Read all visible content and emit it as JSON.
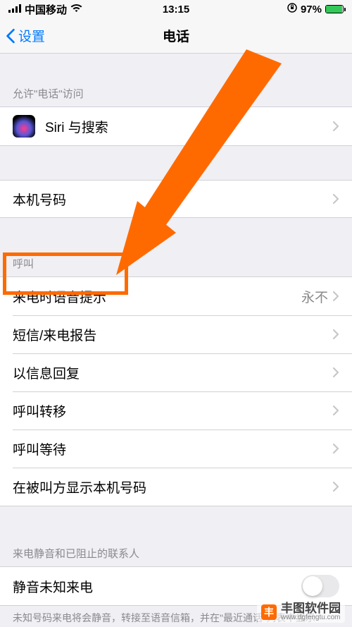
{
  "status": {
    "carrier": "中国移动",
    "time": "13:15",
    "battery": "97%"
  },
  "nav": {
    "back": "设置",
    "title": "电话"
  },
  "section_access": "允许\"电话\"访问",
  "siri": "Siri 与搜索",
  "my_number": "本机号码",
  "section_calls": "呼叫",
  "calls": {
    "announce": {
      "label": "来电时语音提示",
      "value": "永不"
    },
    "report": "短信/来电报告",
    "respond": "以信息回复",
    "forwarding": "呼叫转移",
    "waiting": "呼叫等待",
    "caller_id": "在被叫方显示本机号码"
  },
  "section_silence": "来电静音和已阻止的联系人",
  "silence_unknown": "静音未知来电",
  "silence_footer": "未知号码来电将会静音，转接至语音信箱，并在\"最近通话\"列表中显示",
  "watermark": {
    "name": "丰图软件园",
    "url": "www.dgfengtu.com"
  }
}
